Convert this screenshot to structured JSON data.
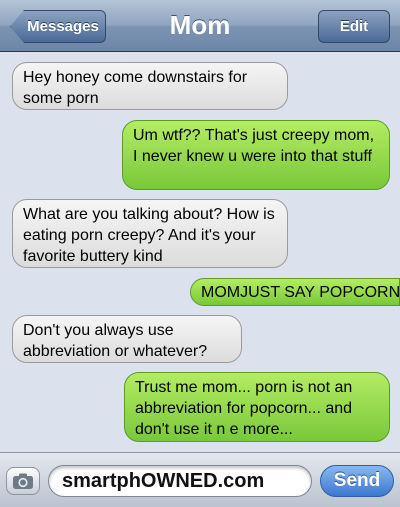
{
  "header": {
    "title": "Mom",
    "back_label": "Messages",
    "edit_label": "Edit"
  },
  "messages": [
    {
      "sender": "them",
      "text": "Hey honey come downstairs for some porn"
    },
    {
      "sender": "me",
      "text": "Um wtf?? That's just creepy mom, I never knew u were into that stuff"
    },
    {
      "sender": "them",
      "text": "What are you talking about? How is eating porn creepy? And it's your favorite buttery kind"
    },
    {
      "sender": "me",
      "text": "MOMJUST SAY POPCORN"
    },
    {
      "sender": "them",
      "text": "Don't you always use abbreviation or whatever?"
    },
    {
      "sender": "me",
      "text": "Trust me mom... porn is not an abbreviation for popcorn... and don't use it n e more..."
    }
  ],
  "composer": {
    "input_value": "smartphOWNED.com",
    "send_label": "Send",
    "camera_icon": "camera-icon"
  },
  "colors": {
    "outgoing_bubble": "#8fd649",
    "incoming_bubble": "#e6e6e6",
    "nav_bar": "#7d94b3",
    "send_button": "#3b78d1"
  }
}
